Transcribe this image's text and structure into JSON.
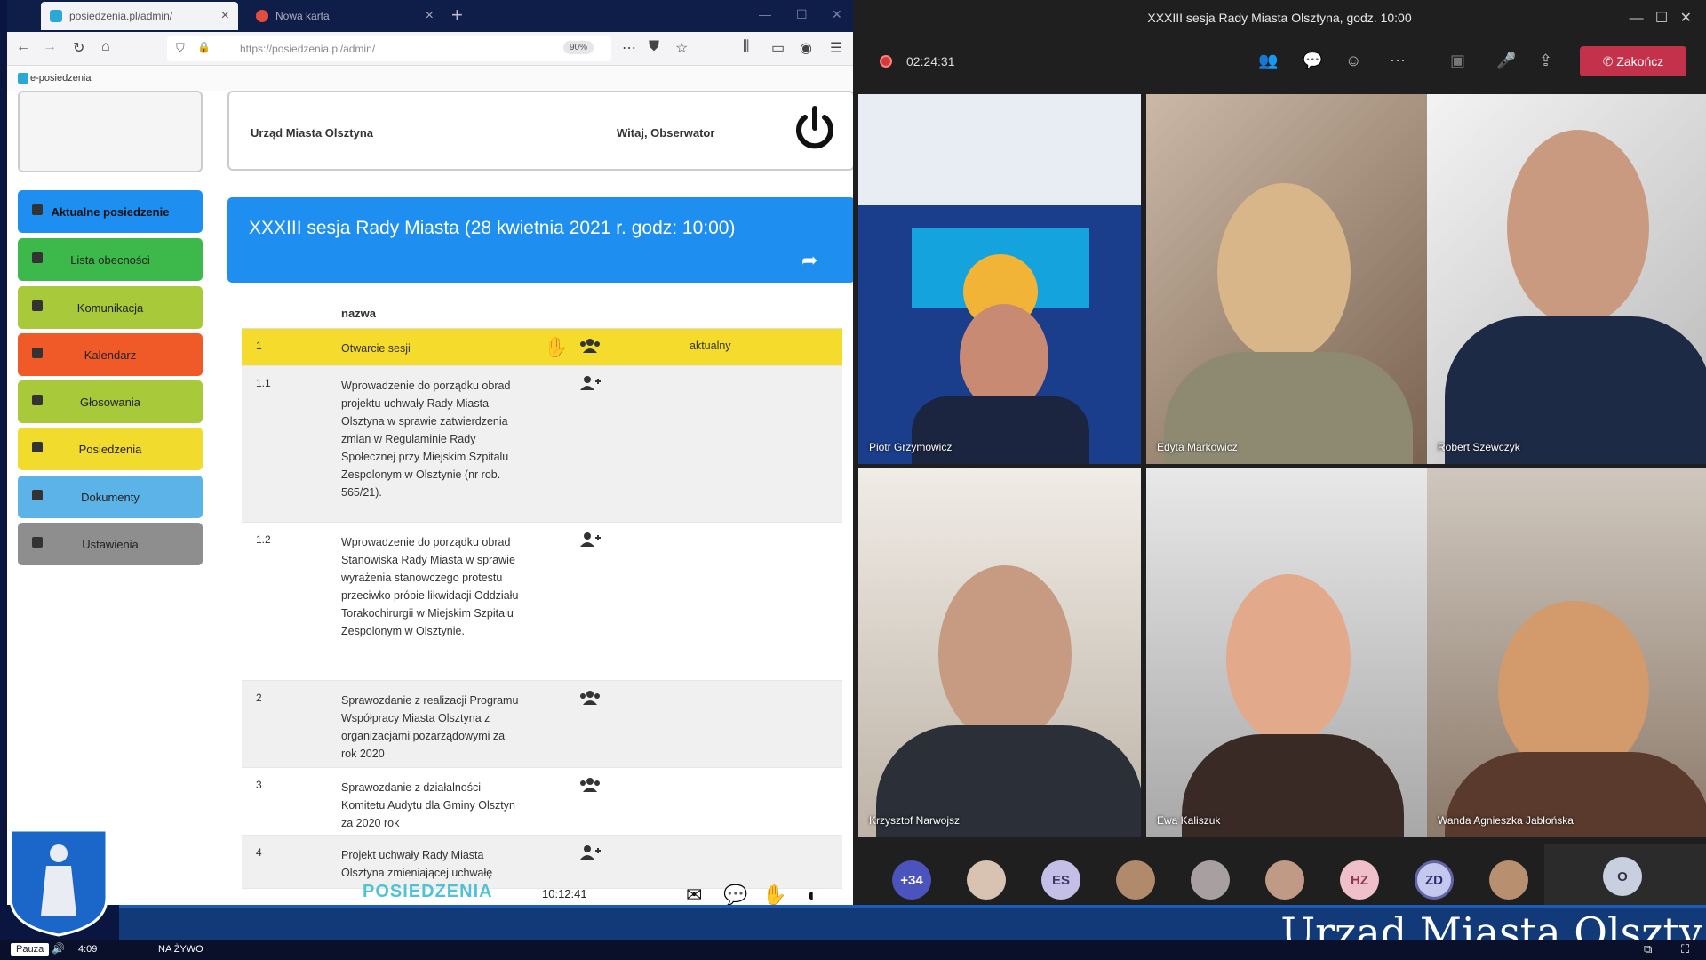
{
  "browser": {
    "tabs": [
      {
        "label": "posiedzenia.pl/admin/"
      },
      {
        "label": "Nowa karta"
      }
    ],
    "url": "https://posiedzenia.pl/admin/",
    "zoom": "90%",
    "bookmark": "e-posiedzenia"
  },
  "app": {
    "organization": "Urząd Miasta Olsztyna",
    "welcome": "Witaj, Obserwator",
    "menu": [
      {
        "label": "Aktualne posiedzenie",
        "color": "#1e8ff0"
      },
      {
        "label": "Lista obecności",
        "color": "#3cb94a"
      },
      {
        "label": "Komunikacja",
        "color": "#a8c93a"
      },
      {
        "label": "Kalendarz",
        "color": "#f05a28"
      },
      {
        "label": "Głosowania",
        "color": "#a8c93a"
      },
      {
        "label": "Posiedzenia",
        "color": "#f1dc2e"
      },
      {
        "label": "Dokumenty",
        "color": "#5bb3e8"
      },
      {
        "label": "Ustawienia",
        "color": "#8e8e8e"
      }
    ],
    "session_title": "XXXIII sesja Rady Miasta (28 kwietnia 2021 r. godz: 10:00)",
    "table": {
      "column_name": "nazwa",
      "rows": [
        {
          "num": "1",
          "text": "Otwarcie sesji",
          "status": "aktualny"
        },
        {
          "num": "1.1",
          "text": "Wprowadzenie do porządku obrad projektu uchwały Rady Miasta Olsztyna w sprawie zatwierdzenia zmian w Regulaminie Rady Społecznej przy Miejskim Szpitalu Zespolonym w Olsztynie (nr rob. 565/21)."
        },
        {
          "num": "1.2",
          "text": "Wprowadzenie do porządku obrad Stanowiska Rady Miasta w sprawie wyrażenia stanowczego protestu przeciwko próbie likwidacji Oddziału Torakochirurgii w Miejskim Szpitalu Zespolonym w Olsztynie."
        },
        {
          "num": "2",
          "text": "Sprawozdanie z realizacji Programu Współpracy Miasta Olsztyna z organizacjami pozarządowymi za rok 2020"
        },
        {
          "num": "3",
          "text": "Sprawozdanie z działalności Komitetu Audytu dla Gminy Olsztyn za 2020 rok"
        },
        {
          "num": "4",
          "text": "Projekt uchwały Rady Miasta Olsztyna zmieniającej uchwałę"
        }
      ]
    },
    "footer_logo": "POSIEDZENIA",
    "clock": "10:12:41"
  },
  "teams": {
    "title": "XXXIII sesja Rady Miasta Olsztyna, godz. 10:00",
    "timer": "02:24:31",
    "end_label": "Zakończ",
    "participants": [
      {
        "name": "Piotr Grzymowicz"
      },
      {
        "name": "Edyta Markowicz"
      },
      {
        "name": "Robert Szewczyk"
      },
      {
        "name": "Krzysztof Narwojsz"
      },
      {
        "name": "Ewa Kaliszuk"
      },
      {
        "name": "Wanda Agnieszka Jabłońska"
      }
    ],
    "tray": {
      "more": "+34",
      "initials_1": "ES",
      "initials_2": "HZ",
      "initials_3": "ZD",
      "initials_4": "O"
    }
  },
  "overlay": {
    "banner_text": "Urząd Miasta Olszty",
    "pause": "Pauza",
    "time": "4:09",
    "live": "NA ŻYWO"
  }
}
